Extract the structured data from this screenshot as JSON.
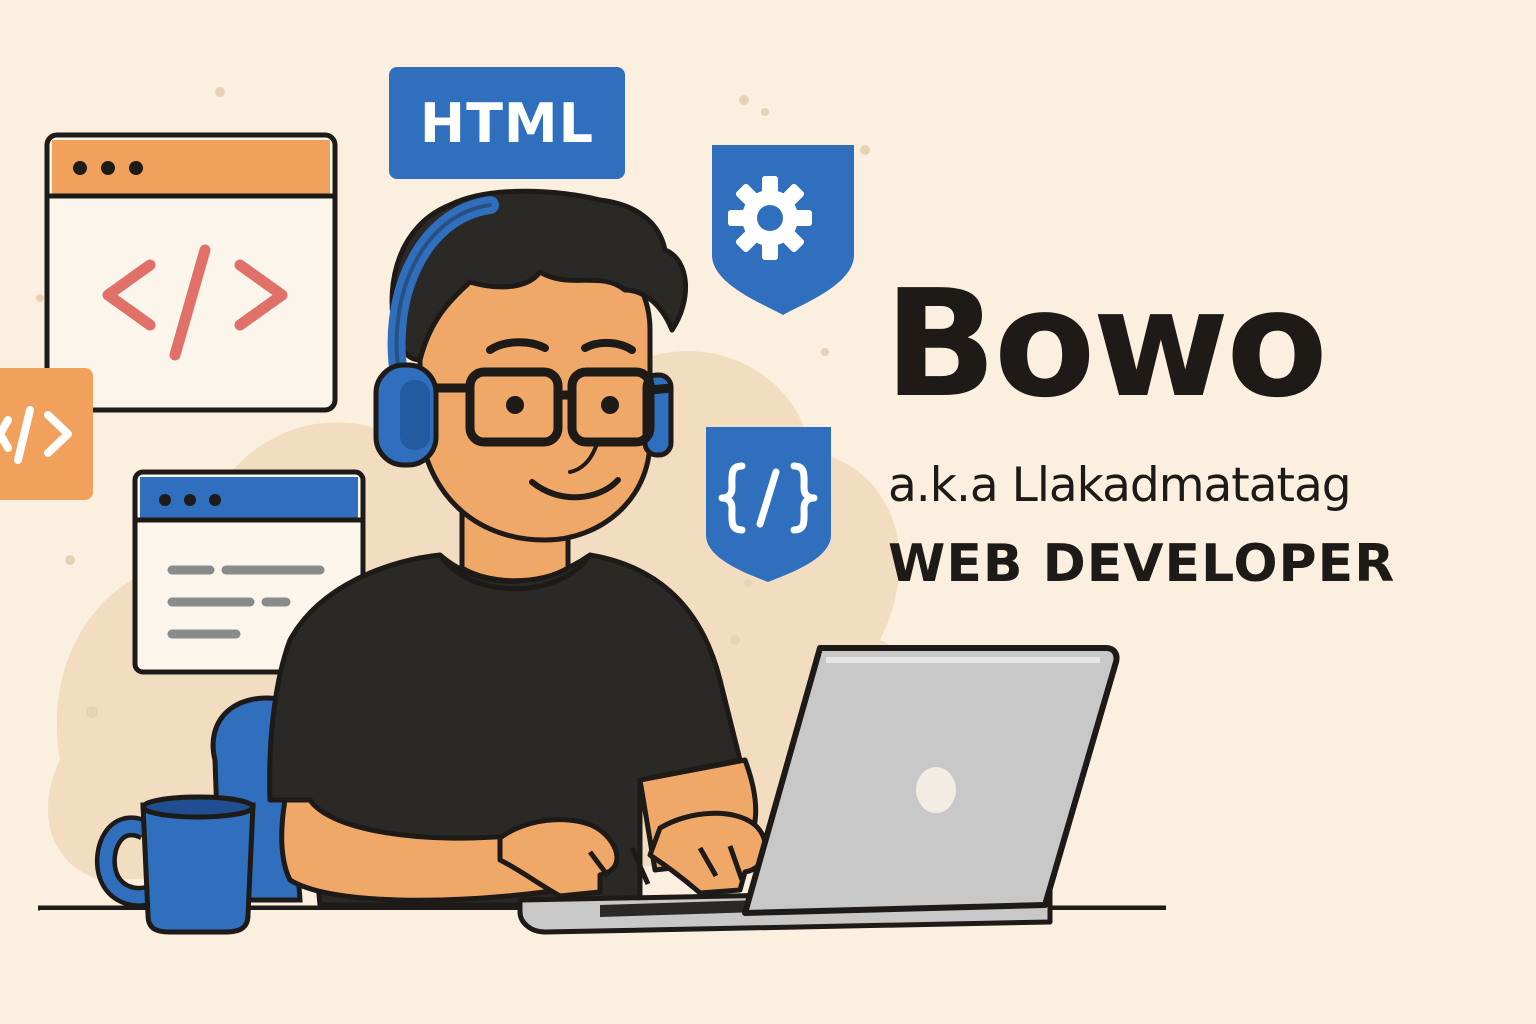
{
  "profile": {
    "name": "Bowo",
    "alias": "a.k.a Llakadmatatag",
    "role": "WEB DEVELOPER"
  },
  "badges": {
    "html": "HTML"
  },
  "icons": {
    "code_window": "code-brackets-icon",
    "side_tag": "code-tag-icon",
    "gear": "gear-icon",
    "braces": "curly-braces-code-icon"
  },
  "colors": {
    "background": "#fbefdf",
    "accent_blue": "#2f6fbe",
    "accent_orange": "#f1a15c",
    "code_red": "#e07068",
    "ink": "#1d1a17",
    "skin": "#f0a868",
    "shirt": "#2b2926",
    "laptop": "#c8c8c8"
  }
}
